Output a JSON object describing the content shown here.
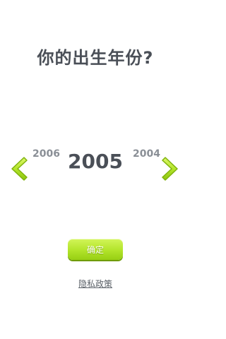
{
  "header": {
    "title": "你的出生年份?"
  },
  "year_picker": {
    "previous_year": "2006",
    "selected_year": "2005",
    "next_year": "2004",
    "left_arrow_icon": "chevron-left-icon",
    "right_arrow_icon": "chevron-right-icon",
    "accent_color": "#9ad818"
  },
  "actions": {
    "confirm_label": "确定",
    "privacy_label": "隐私政策"
  }
}
